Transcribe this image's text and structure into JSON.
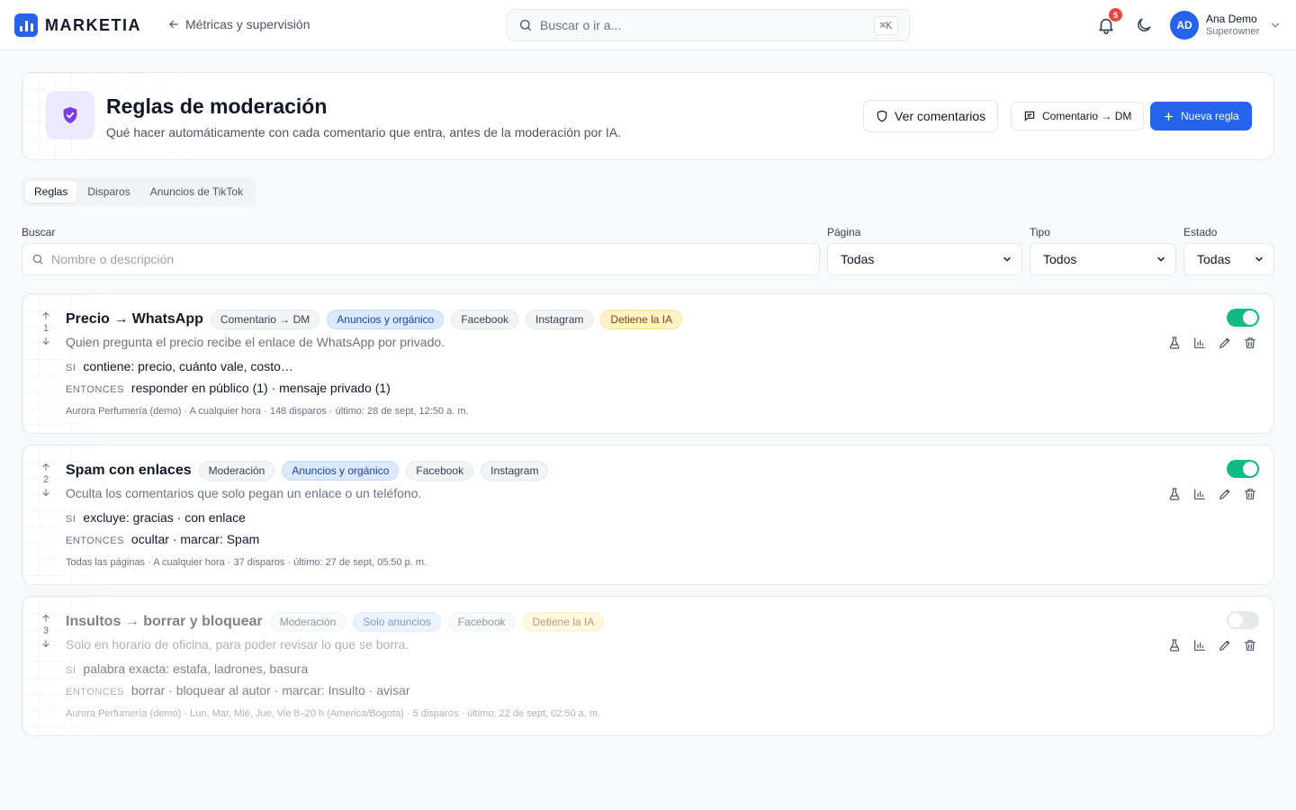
{
  "brand": {
    "name": "MARKETIA",
    "accent": "#2563eb"
  },
  "topbar": {
    "back_label": "Métricas y supervisión",
    "search_placeholder": "Buscar o ir a...",
    "search_shortcut": "⌘K",
    "notifications_count": "5",
    "user": {
      "initials": "AD",
      "name": "Ana Demo",
      "role": "Superowner"
    }
  },
  "header": {
    "title": "Reglas de moderación",
    "subtitle": "Qué hacer automáticamente con cada comentario que entra, antes de la moderación por IA.",
    "buttons": {
      "comments": "Ver comentarios",
      "comment_dm": "Comentario → DM",
      "new_rule": "Nueva regla"
    }
  },
  "tabs": [
    {
      "label": "Reglas",
      "active": true
    },
    {
      "label": "Disparos",
      "active": false
    },
    {
      "label": "Anuncios de TikTok",
      "active": false
    }
  ],
  "filters": {
    "search_label": "Buscar",
    "search_placeholder": "Nombre o descripción",
    "page_label": "Página",
    "page_value": "Todas",
    "type_label": "Tipo",
    "type_value": "Todos",
    "status_label": "Estado",
    "status_value": "Todas"
  },
  "rules": [
    {
      "order": "1",
      "title": "Precio → WhatsApp",
      "chips": [
        {
          "label": "Comentario → DM",
          "style": "gray"
        },
        {
          "label": "Anuncios y orgánico",
          "style": "blue"
        },
        {
          "label": "Facebook",
          "style": "gray"
        },
        {
          "label": "Instagram",
          "style": "gray"
        },
        {
          "label": "Detiene la IA",
          "style": "amber"
        }
      ],
      "description": "Quien pregunta el precio recibe el enlace de WhatsApp por privado.",
      "if_keyword": "SI",
      "if_text": "contiene: precio, cuánto vale, costo…",
      "then_keyword": "ENTONCES",
      "then_text": "responder en público (1) · mensaje privado (1)",
      "meta": "Aurora Perfumería (demo) · A cualquier hora · 148 disparos · último: 28 de sept, 12:50 a. m.",
      "enabled": true
    },
    {
      "order": "2",
      "title": "Spam con enlaces",
      "chips": [
        {
          "label": "Moderación",
          "style": "gray"
        },
        {
          "label": "Anuncios y orgánico",
          "style": "blue"
        },
        {
          "label": "Facebook",
          "style": "gray"
        },
        {
          "label": "Instagram",
          "style": "gray"
        }
      ],
      "description": "Oculta los comentarios que solo pegan un enlace o un teléfono.",
      "if_keyword": "SI",
      "if_text": "excluye: gracias · con enlace",
      "then_keyword": "ENTONCES",
      "then_text": "ocultar · marcar: Spam",
      "meta": "Todas las páginas · A cualquier hora · 37 disparos · último: 27 de sept, 05:50 p. m.",
      "enabled": true
    },
    {
      "order": "3",
      "title": "Insultos → borrar y bloquear",
      "chips": [
        {
          "label": "Moderación",
          "style": "gray"
        },
        {
          "label": "Solo anuncios",
          "style": "blue"
        },
        {
          "label": "Facebook",
          "style": "gray"
        },
        {
          "label": "Detiene la IA",
          "style": "amber"
        }
      ],
      "description": "Solo en horario de oficina, para poder revisar lo que se borra.",
      "if_keyword": "SI",
      "if_text": "palabra exacta: estafa, ladrones, basura",
      "then_keyword": "ENTONCES",
      "then_text": "borrar · bloquear al autor · marcar: Insulto · avisar",
      "meta": "Aurora Perfumería (demo) · Lun, Mar, Mié, Jue, Vie 8–20 h (America/Bogota) · 5 disparos · último: 22 de sept, 02:50 a. m.",
      "enabled": false
    }
  ],
  "icons": [
    "back-arrow-icon",
    "search-icon",
    "bell-icon",
    "moon-icon",
    "chevron-down-icon",
    "shield-icon",
    "plus-icon",
    "chat-icon",
    "arrow-up-icon",
    "arrow-down-icon",
    "flask-icon",
    "bar-chart-icon",
    "pencil-icon",
    "trash-icon"
  ]
}
